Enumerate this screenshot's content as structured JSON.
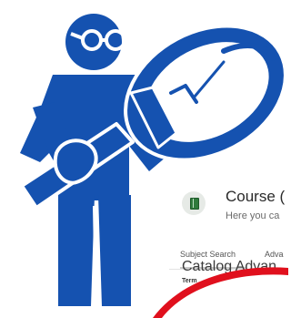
{
  "catalog": {
    "title": "Course (",
    "subtitle": "Here you ca",
    "tabs": [
      "Subject Search",
      "Adva"
    ],
    "heading": "Catalog Advan",
    "term_label": "Term"
  },
  "colors": {
    "figure": "#1552b0",
    "lens": "#ffffff",
    "outline": "#ffffff",
    "hand_drawn_arc": "#e0101d",
    "icon_green": "#2f7a3c"
  },
  "icons": {
    "person": "person-with-magnifier-icon",
    "book": "book-icon"
  }
}
